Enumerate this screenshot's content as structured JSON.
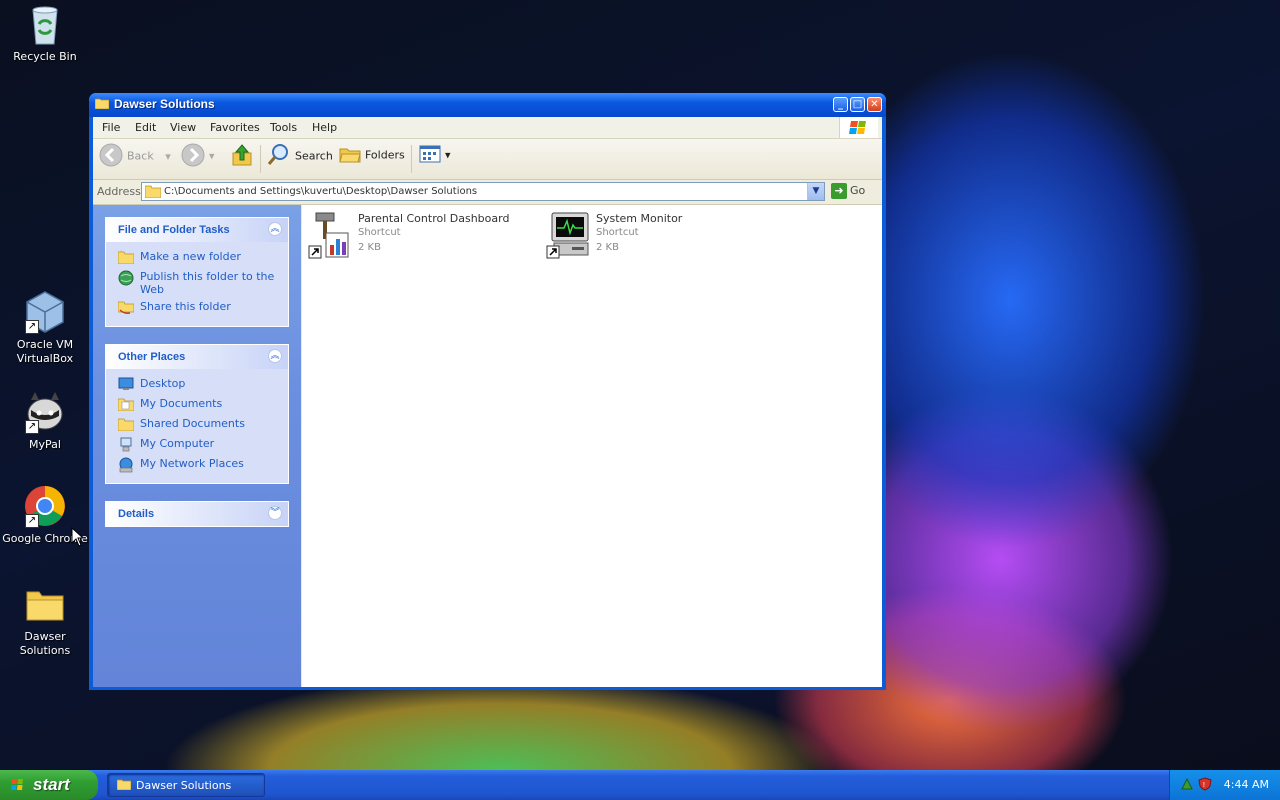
{
  "desktop": {
    "icons": [
      {
        "label": "Recycle Bin"
      },
      {
        "label": "Oracle VM VirtualBox"
      },
      {
        "label": "MyPal"
      },
      {
        "label": "Google Chrome"
      },
      {
        "label": "Dawser Solutions"
      }
    ]
  },
  "window": {
    "title": "Dawser Solutions",
    "menu": [
      "File",
      "Edit",
      "View",
      "Favorites",
      "Tools",
      "Help"
    ],
    "toolbar": {
      "back": "Back",
      "search": "Search",
      "folders": "Folders"
    },
    "address": {
      "label": "Address",
      "value": "C:\\Documents and Settings\\kuvertu\\Desktop\\Dawser Solutions",
      "go": "Go"
    },
    "tasks_panel": {
      "title": "File and Folder Tasks",
      "items": [
        "Make a new folder",
        "Publish this folder to the Web",
        "Share this folder"
      ]
    },
    "places_panel": {
      "title": "Other Places",
      "items": [
        "Desktop",
        "My Documents",
        "Shared Documents",
        "My Computer",
        "My Network Places"
      ]
    },
    "details_panel": {
      "title": "Details"
    },
    "files": [
      {
        "name": "Parental Control Dashboard",
        "type": "Shortcut",
        "size": "2 KB"
      },
      {
        "name": "System Monitor",
        "type": "Shortcut",
        "size": "2 KB"
      }
    ]
  },
  "taskbar": {
    "start": "start",
    "task": "Dawser Solutions",
    "clock": "4:44 AM"
  },
  "colors": {
    "titlebar": "#0a58e0",
    "taskpane": "#6b8fe0",
    "link": "#215dc6",
    "start": "#2f9e32"
  }
}
